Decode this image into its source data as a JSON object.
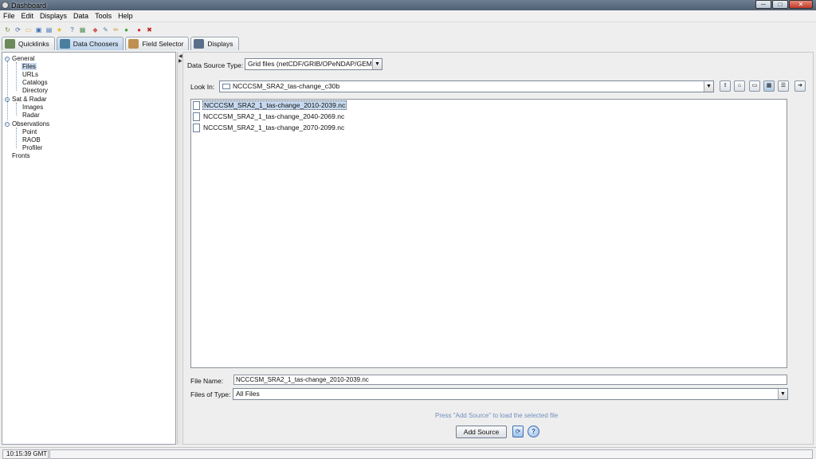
{
  "window": {
    "title": "Dashboard",
    "controls": [
      "─",
      "□",
      "✕"
    ]
  },
  "menu": [
    "File",
    "Edit",
    "Displays",
    "Data",
    "Tools",
    "Help"
  ],
  "toolbar_icons": [
    {
      "name": "refresh-icon",
      "glyph": "↻",
      "color": "#6a8a3a"
    },
    {
      "name": "reload-icon",
      "glyph": "⟳",
      "color": "#4a6fa0"
    },
    {
      "name": "open-folder-icon",
      "glyph": "▭",
      "color": "#d9a640"
    },
    {
      "name": "save-icon",
      "glyph": "▣",
      "color": "#3a6fb0"
    },
    {
      "name": "save-all-icon",
      "glyph": "▤",
      "color": "#3a6fb0"
    },
    {
      "name": "favorite-icon",
      "glyph": "★",
      "color": "#e8b920"
    },
    {
      "name": "help-icon",
      "glyph": "?",
      "color": "#3b6fb0"
    },
    {
      "name": "image-icon",
      "glyph": "▦",
      "color": "#5a8f5a"
    },
    {
      "name": "eraser-icon",
      "glyph": "◆",
      "color": "#d06060"
    },
    {
      "name": "tool-icon",
      "glyph": "✎",
      "color": "#5a7fb0"
    },
    {
      "name": "pencil-icon",
      "glyph": "✏",
      "color": "#c89a30"
    },
    {
      "name": "globe-icon",
      "glyph": "●",
      "color": "#3a9f3a"
    },
    {
      "name": "stop-icon",
      "glyph": "●",
      "color": "#d03030"
    },
    {
      "name": "close-all-icon",
      "glyph": "✖",
      "color": "#c02020"
    }
  ],
  "tabs": [
    {
      "label": "Quicklinks",
      "icon": "quicklinks-icon",
      "color": "#6a8a5a",
      "active": false
    },
    {
      "label": "Data Choosers",
      "icon": "data-choosers-icon",
      "color": "#4a7fa0",
      "active": true
    },
    {
      "label": "Field Selector",
      "icon": "field-selector-icon",
      "color": "#c09050",
      "active": false
    },
    {
      "label": "Displays",
      "icon": "displays-icon",
      "color": "#5a6f8a",
      "active": false
    }
  ],
  "tree": {
    "groups": [
      {
        "label": "General",
        "children": [
          "Files",
          "URLs",
          "Catalogs",
          "Directory"
        ]
      },
      {
        "label": "Sat & Radar",
        "children": [
          "Images",
          "Radar"
        ]
      },
      {
        "label": "Observations",
        "children": [
          "Point",
          "RAOB",
          "Profiler"
        ]
      }
    ],
    "leaf": "Fronts",
    "selected": "Files"
  },
  "chooser": {
    "source_type_label": "Data Source Type:",
    "source_type_value": "Grid files (netCDF/GRIB/OPeNDAP/GEMPAK)",
    "look_in_label": "Look In:",
    "look_in_value": "NCCCSM_SRA2_tas-change_c30b",
    "files": [
      "NCCCSM_SRA2_1_tas-change_2010-2039.nc",
      "NCCCSM_SRA2_1_tas-change_2040-2069.nc",
      "NCCCSM_SRA2_1_tas-change_2070-2099.nc"
    ],
    "file_name_label": "File Name:",
    "file_name_value": "NCCCSM_SRA2_1_tas-change_2010-2039.nc",
    "files_of_type_label": "Files of Type:",
    "files_of_type_value": "All Files",
    "hint": "Press \"Add Source\" to load the selected file",
    "add_source_label": "Add Source"
  },
  "status": {
    "time": "10:15:39 GMT"
  }
}
